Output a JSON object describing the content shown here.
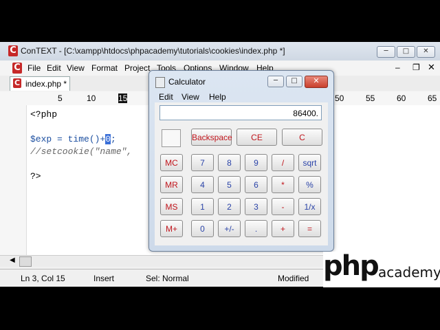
{
  "editor": {
    "app_icon": "C",
    "title": "ConTEXT - [C:\\xampp\\htdocs\\phpacademy\\tutorials\\cookies\\index.php *]",
    "menu": [
      "File",
      "Edit",
      "View",
      "Format",
      "Project",
      "Tools",
      "Options",
      "Window",
      "Help"
    ],
    "tab": "index.php *",
    "ruler": [
      "5",
      "10",
      "15",
      "50",
      "55",
      "60",
      "65"
    ],
    "code": {
      "line1": "<?php",
      "line3_a": "$exp = time()+",
      "line3_cursor": "0",
      "line3_b": ";",
      "line4": "//setcookie(\"name\",",
      "line6": "?>"
    },
    "status": {
      "position": "Ln 3, Col 15",
      "mode": "Insert",
      "selection": "Sel: Normal",
      "modified": "Modified"
    }
  },
  "calculator": {
    "title": "Calculator",
    "menu": [
      "Edit",
      "View",
      "Help"
    ],
    "display": "86400.",
    "keys": {
      "backspace": "Backspace",
      "ce": "CE",
      "c": "C",
      "mc": "MC",
      "mr": "MR",
      "ms": "MS",
      "mplus": "M+",
      "n7": "7",
      "n8": "8",
      "n9": "9",
      "div": "/",
      "sqrt": "sqrt",
      "n4": "4",
      "n5": "5",
      "n6": "6",
      "mul": "*",
      "pct": "%",
      "n1": "1",
      "n2": "2",
      "n3": "3",
      "sub": "-",
      "inv": "1/x",
      "n0": "0",
      "sign": "+/-",
      "dot": ".",
      "add": "+",
      "eq": "="
    }
  },
  "logo": {
    "php": "php",
    "academy": "academy"
  },
  "icons": [
    "app-icon",
    "minimize-icon",
    "maximize-icon",
    "close-icon",
    "calculator-icon"
  ]
}
